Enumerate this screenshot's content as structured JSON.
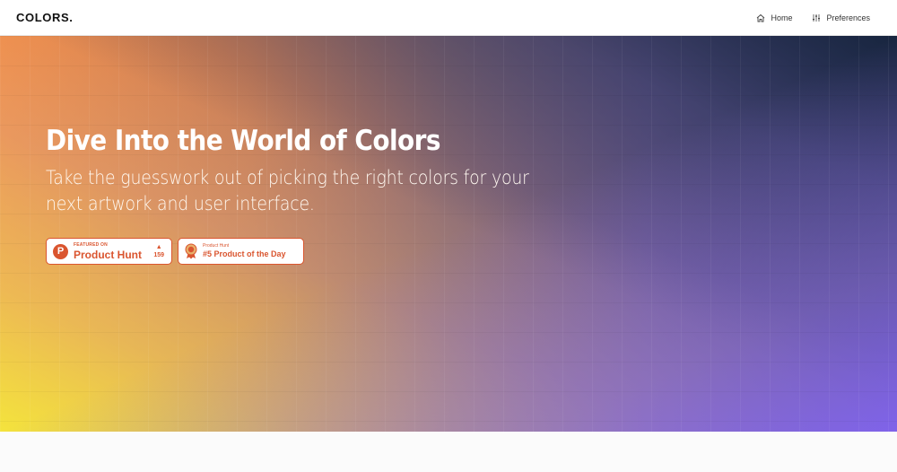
{
  "navbar": {
    "brand": "COLORS.",
    "links": [
      {
        "label": "Home",
        "icon": "home-icon"
      },
      {
        "label": "Preferences",
        "icon": "sliders-icon"
      }
    ]
  },
  "hero": {
    "title": "Dive Into the World of Colors",
    "subtitle": "Take the guesswork out of picking the right colors for your next artwork and user interface.",
    "colors": {
      "top_left": "#f28a45",
      "bottom_left": "#f4e83c",
      "top_right": "#16243c",
      "bottom_right": "#8264f0"
    }
  },
  "badges": [
    {
      "small_text": "FEATURED ON",
      "big_text": "Product Hunt",
      "votes": "159",
      "icon": "producthunt-icon"
    },
    {
      "small_text": "Product Hunt",
      "big_text": "#5 Product of the Day",
      "icon": "medal-icon"
    }
  ],
  "accent": "#da552f"
}
